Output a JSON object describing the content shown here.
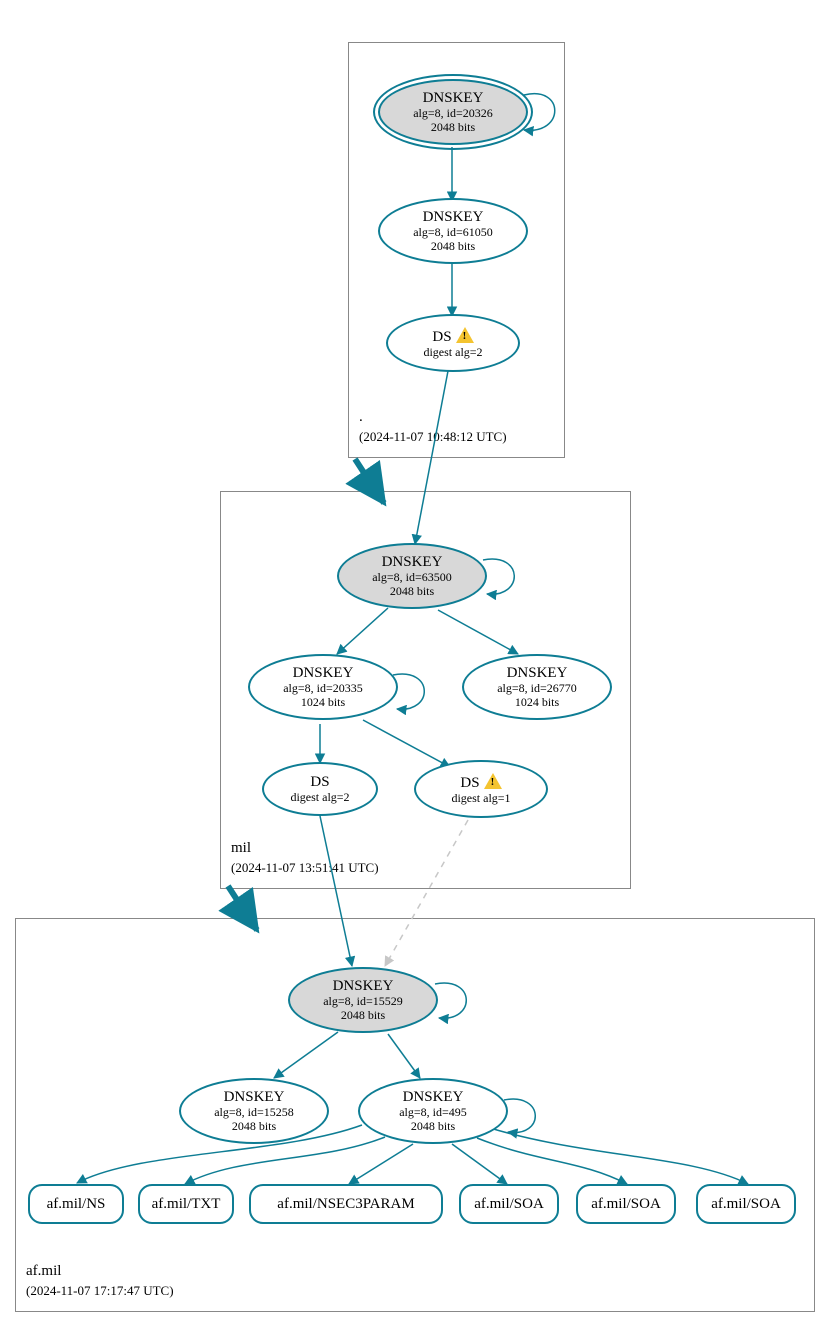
{
  "colors": {
    "node_stroke": "#0e7d94",
    "filled_bg": "#d8d8d8",
    "dashed_stroke": "#c7c7c7",
    "warn": "#f4c430"
  },
  "zones": {
    "root": {
      "label": ".",
      "timestamp": "(2024-11-07 10:48:12 UTC)"
    },
    "mil": {
      "label": "mil",
      "timestamp": "(2024-11-07 13:51:41 UTC)"
    },
    "afmil": {
      "label": "af.mil",
      "timestamp": "(2024-11-07 17:17:47 UTC)"
    }
  },
  "nodes": {
    "root_ksk": {
      "title": "DNSKEY",
      "l1": "alg=8, id=20326",
      "l2": "2048 bits"
    },
    "root_zsk": {
      "title": "DNSKEY",
      "l1": "alg=8, id=61050",
      "l2": "2048 bits"
    },
    "root_ds": {
      "title": "DS",
      "l1": "digest alg=2",
      "warn": true
    },
    "mil_ksk": {
      "title": "DNSKEY",
      "l1": "alg=8, id=63500",
      "l2": "2048 bits"
    },
    "mil_zsk1": {
      "title": "DNSKEY",
      "l1": "alg=8, id=20335",
      "l2": "1024 bits"
    },
    "mil_zsk2": {
      "title": "DNSKEY",
      "l1": "alg=8, id=26770",
      "l2": "1024 bits"
    },
    "mil_ds1": {
      "title": "DS",
      "l1": "digest alg=2"
    },
    "mil_ds2": {
      "title": "DS",
      "l1": "digest alg=1",
      "warn": true
    },
    "af_ksk": {
      "title": "DNSKEY",
      "l1": "alg=8, id=15529",
      "l2": "2048 bits"
    },
    "af_zskA": {
      "title": "DNSKEY",
      "l1": "alg=8, id=15258",
      "l2": "2048 bits"
    },
    "af_zskB": {
      "title": "DNSKEY",
      "l1": "alg=8, id=495",
      "l2": "2048 bits"
    },
    "rr1": {
      "title": "af.mil/NS"
    },
    "rr2": {
      "title": "af.mil/TXT"
    },
    "rr3": {
      "title": "af.mil/NSEC3PARAM"
    },
    "rr4": {
      "title": "af.mil/SOA"
    },
    "rr5": {
      "title": "af.mil/SOA"
    },
    "rr6": {
      "title": "af.mil/SOA"
    }
  }
}
